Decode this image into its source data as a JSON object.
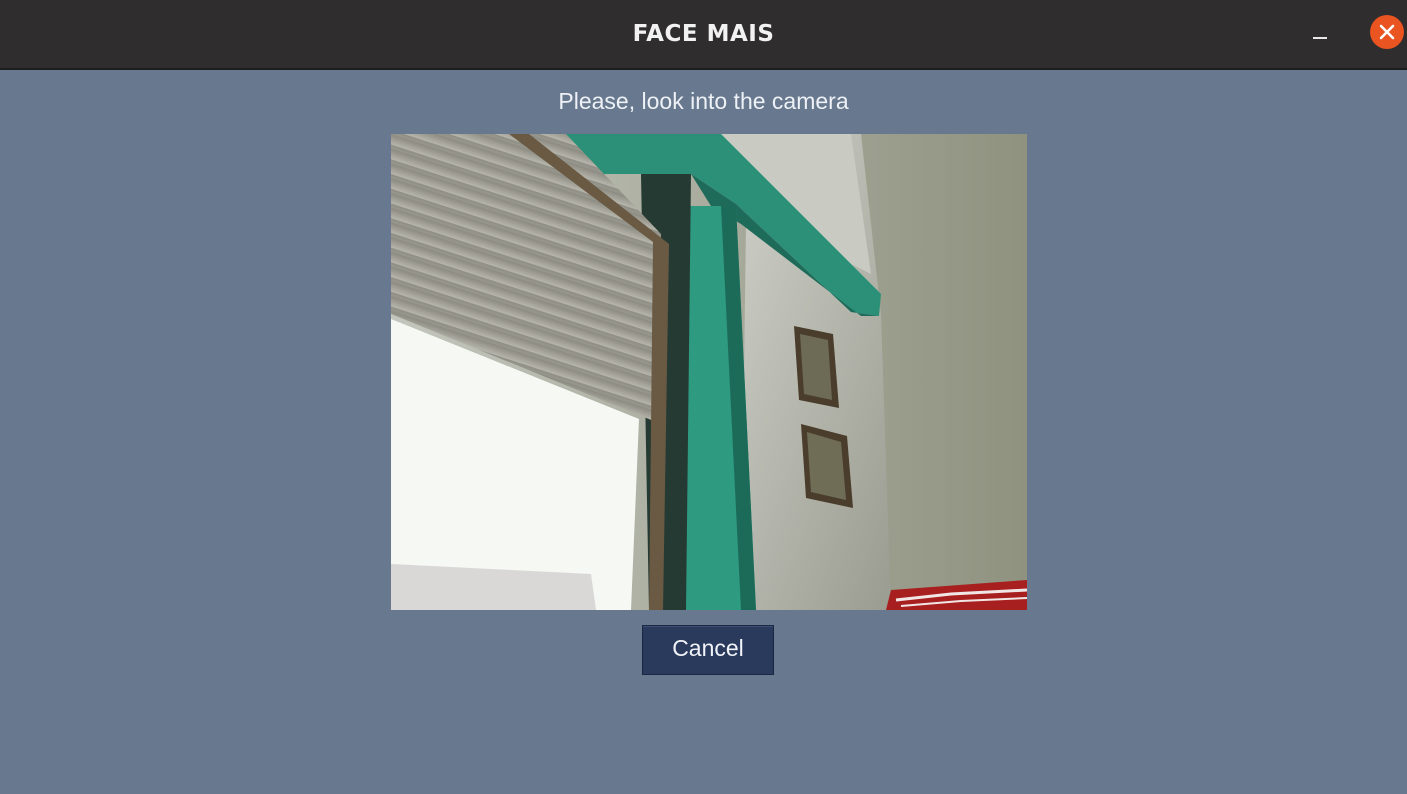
{
  "window": {
    "title": "FACE MAIS",
    "minimize_icon": "minimize-icon",
    "close_icon": "close-icon",
    "close_color": "#e95420"
  },
  "main": {
    "prompt": "Please, look into the camera",
    "camera_feed": "camera-preview",
    "cancel_label": "Cancel"
  },
  "colors": {
    "background": "#67788f",
    "titlebar": "#2f2d2e",
    "button": "#2a3a5c"
  }
}
